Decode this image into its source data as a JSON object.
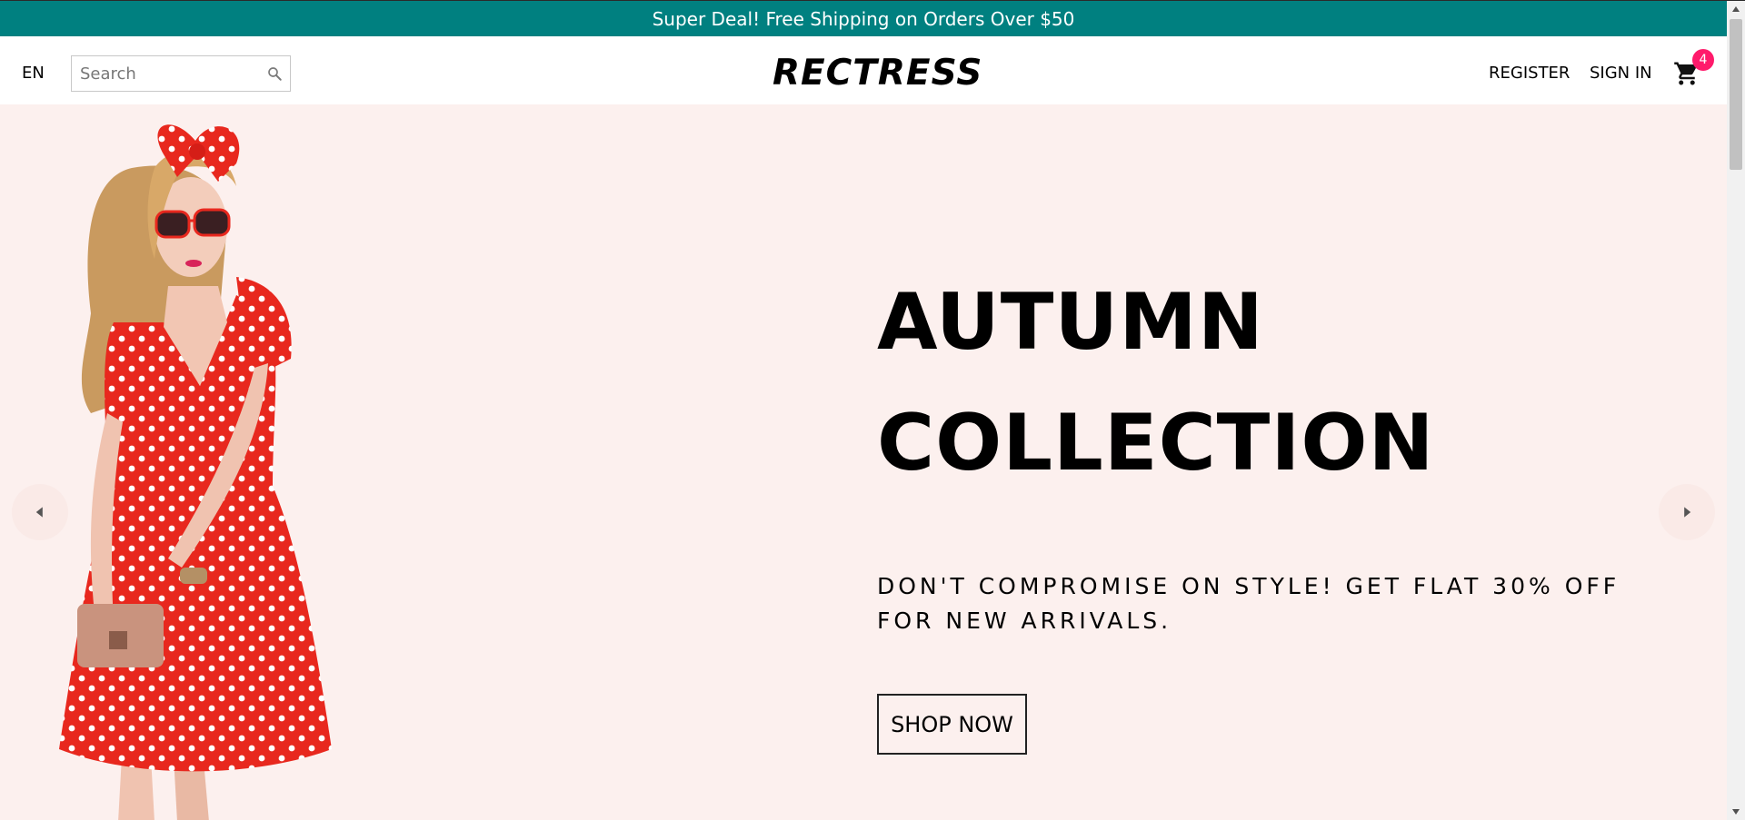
{
  "announcement": {
    "text": "Super Deal! Free Shipping on Orders Over $50"
  },
  "header": {
    "language": "EN",
    "search": {
      "placeholder": "Search",
      "value": ""
    },
    "logo": "RECTRESS",
    "register_label": "REGISTER",
    "signin_label": "SIGN IN",
    "cart_count": "4"
  },
  "hero": {
    "title_line1": "AUTUMN",
    "title_line2": "COLLECTION",
    "subtitle": "DON'T COMPROMISE ON STYLE! GET FLAT 30% OFF FOR NEW ARRIVALS.",
    "button_label": "SHOP NOW",
    "background_color": "#fcf0ee"
  },
  "colors": {
    "announcement_bg": "#008080",
    "badge_bg": "#ff1a6b",
    "dress": "#e8281e"
  },
  "icons": [
    "search-icon",
    "cart-icon",
    "arrow-left-icon",
    "arrow-right-icon"
  ]
}
